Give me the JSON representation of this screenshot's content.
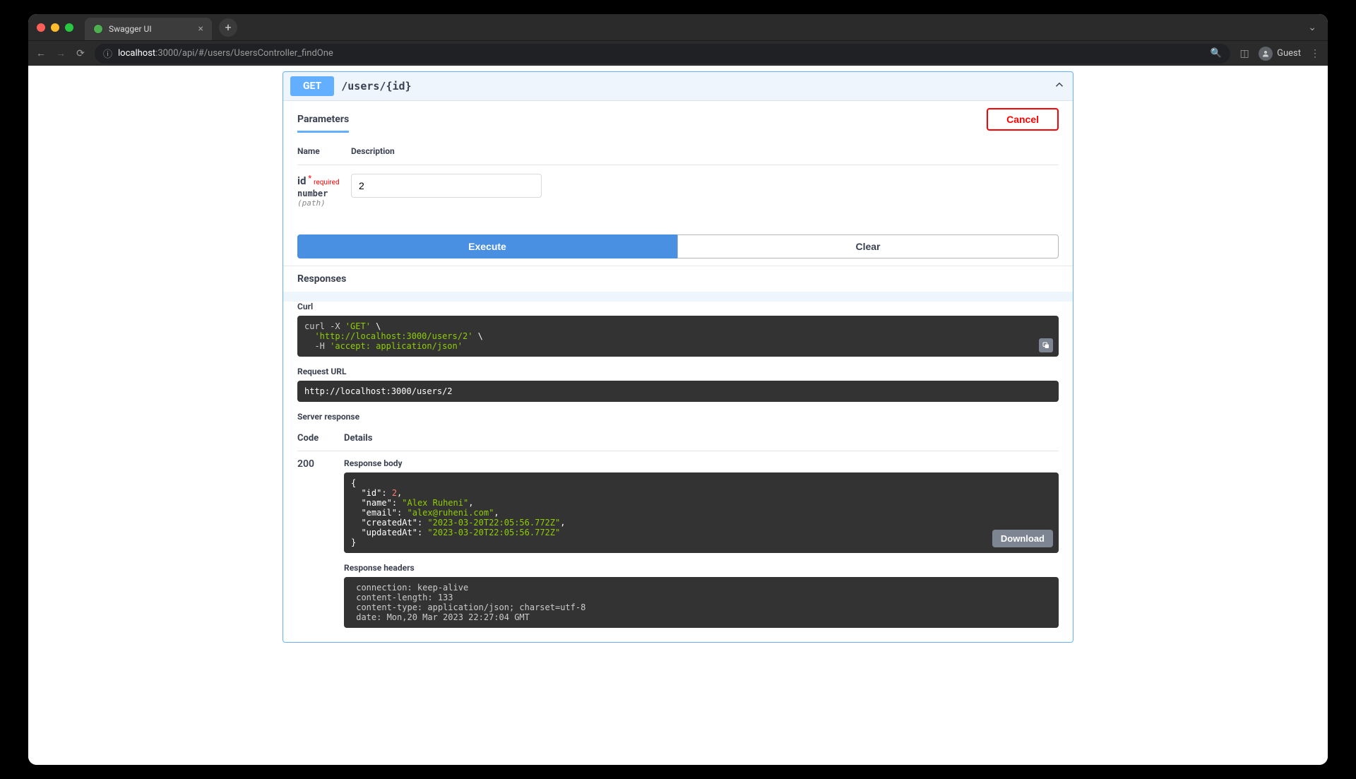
{
  "browser": {
    "tab_title": "Swagger UI",
    "url_host": "localhost",
    "url_path": ":3000/api/#/users/UsersController_findOne",
    "guest_label": "Guest"
  },
  "operation": {
    "method": "GET",
    "path": "/users/{id}"
  },
  "sections": {
    "parameters_label": "Parameters",
    "cancel_label": "Cancel",
    "responses_label": "Responses"
  },
  "param_headers": {
    "name": "Name",
    "description": "Description"
  },
  "parameters": [
    {
      "name": "id",
      "required_label": "required",
      "type": "number",
      "in": "(path)",
      "value": "2",
      "placeholder": "id"
    }
  ],
  "buttons": {
    "execute": "Execute",
    "clear": "Clear",
    "download": "Download"
  },
  "response": {
    "curl_label": "Curl",
    "curl_cmd_prefix": "curl -X ",
    "curl_method": "'GET'",
    "curl_url": "'http://localhost:3000/users/2'",
    "curl_header_flag": "  -H ",
    "curl_header": "'accept: application/json'",
    "request_url_label": "Request URL",
    "request_url": "http://localhost:3000/users/2",
    "server_response_label": "Server response",
    "code_header": "Code",
    "details_header": "Details",
    "status_code": "200",
    "body_label": "Response body",
    "headers_label": "Response headers",
    "body": {
      "id": 2,
      "name": "Alex Ruheni",
      "email": "alex@ruheni.com",
      "createdAt": "2023-03-20T22:05:56.772Z",
      "updatedAt": "2023-03-20T22:05:56.772Z"
    },
    "headers": {
      "connection": "keep-alive",
      "content-length": "133",
      "content-type": "application/json; charset=utf-8",
      "date": "Mon,20 Mar 2023 22:27:04 GMT"
    }
  }
}
